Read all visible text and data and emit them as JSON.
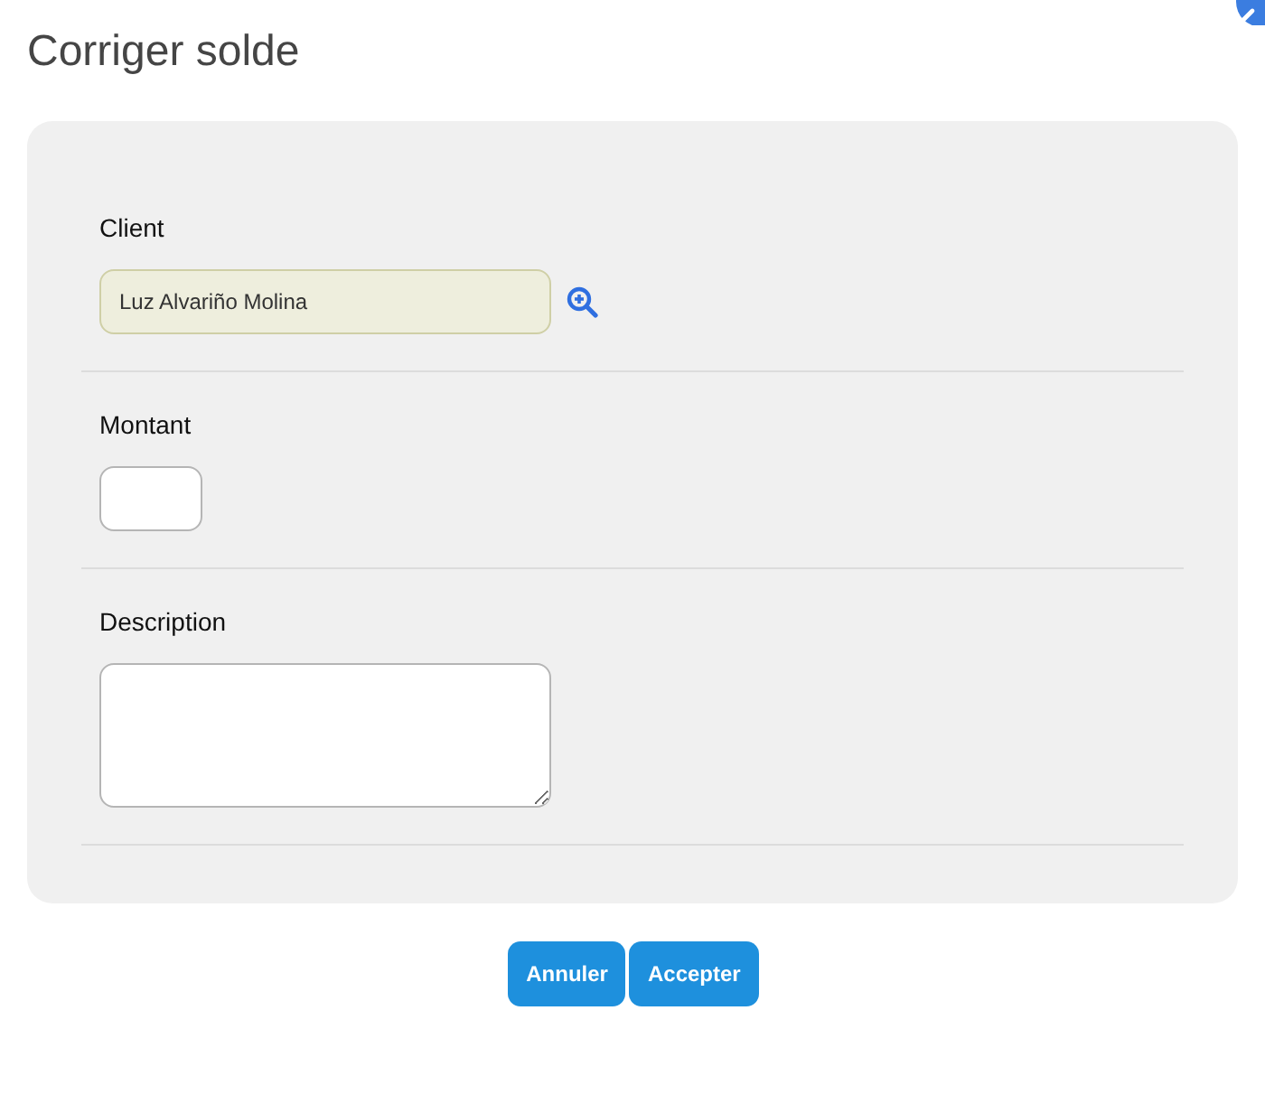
{
  "dialog": {
    "title": "Corriger solde"
  },
  "fields": [
    {
      "kind": "lookup",
      "label": "Client",
      "value": "Luz Alvariño Molina",
      "readonly": true
    },
    {
      "kind": "number",
      "label": "Montant",
      "readonly": false
    },
    {
      "kind": "textarea",
      "label": "Description",
      "readonly": false
    }
  ],
  "buttons": [
    {
      "label": "Annuler"
    },
    {
      "label": "Accepter"
    }
  ]
}
